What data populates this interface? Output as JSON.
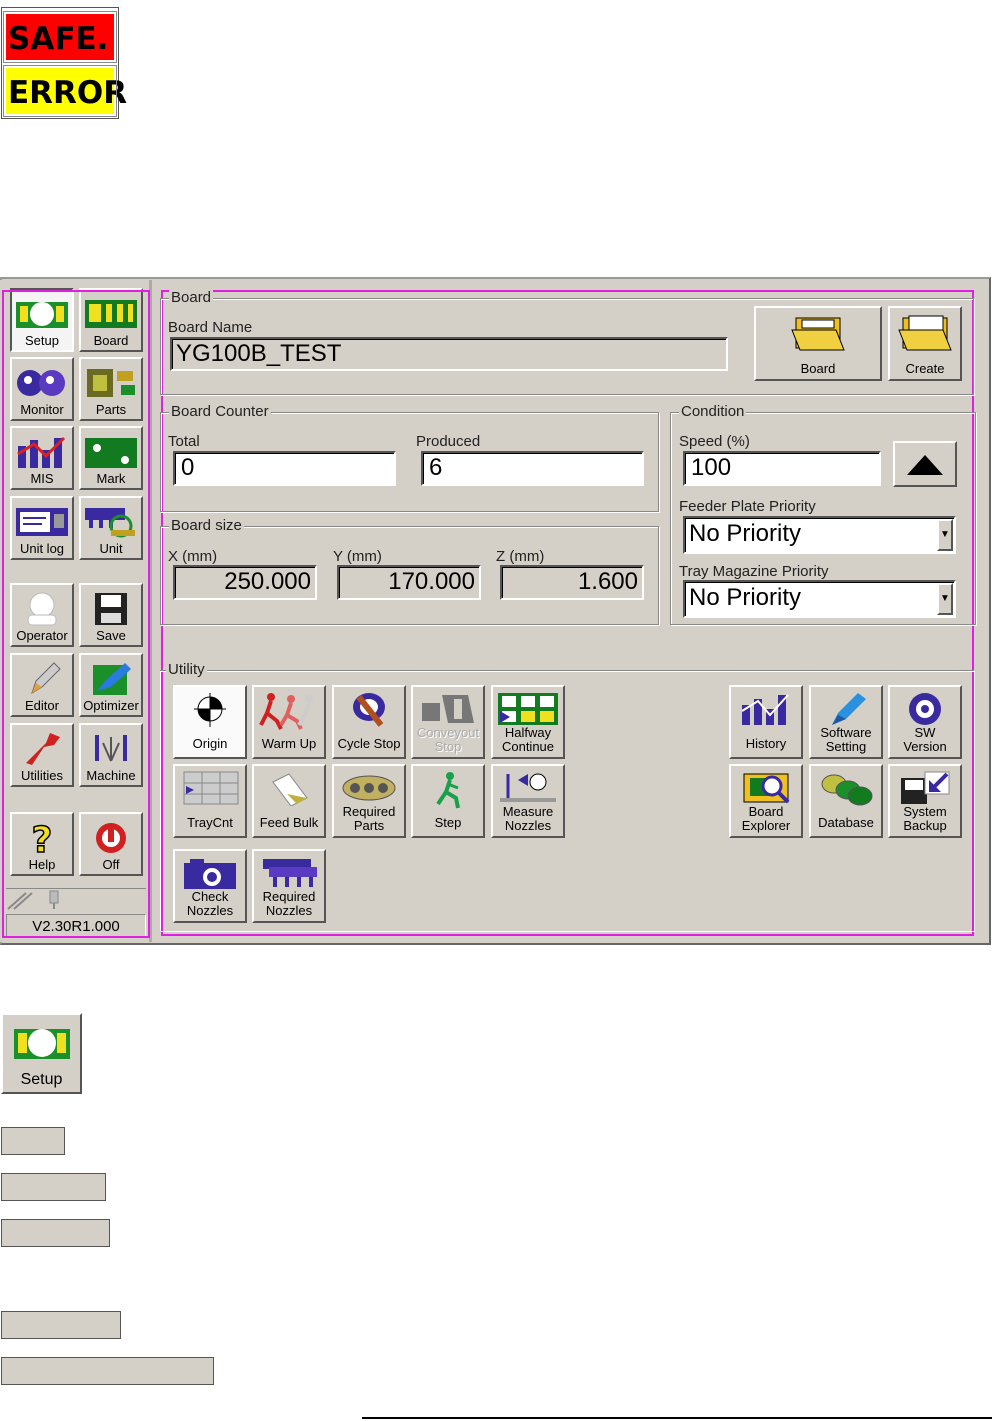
{
  "status": {
    "safe": "SAFE.",
    "error": "ERROR"
  },
  "sidebar": {
    "buttons": [
      {
        "label": "Setup",
        "icon": "setup-icon"
      },
      {
        "label": "Board",
        "icon": "board-icon"
      },
      {
        "label": "Monitor",
        "icon": "monitor-icon"
      },
      {
        "label": "Parts",
        "icon": "parts-icon"
      },
      {
        "label": "MIS",
        "icon": "mis-icon"
      },
      {
        "label": "Mark",
        "icon": "mark-icon"
      },
      {
        "label": "Unit log",
        "icon": "unit-log-icon"
      },
      {
        "label": "Unit",
        "icon": "unit-icon"
      },
      {
        "label": "Operator",
        "icon": "operator-icon"
      },
      {
        "label": "Save",
        "icon": "save-icon"
      },
      {
        "label": "Editor",
        "icon": "editor-icon"
      },
      {
        "label": "Optimizer",
        "icon": "optimizer-icon"
      },
      {
        "label": "Utilities",
        "icon": "utilities-icon"
      },
      {
        "label": "Machine",
        "icon": "machine-icon"
      },
      {
        "label": "Help",
        "icon": "help-icon"
      },
      {
        "label": "Off",
        "icon": "power-off-icon"
      }
    ],
    "version": "V2.30R1.000"
  },
  "board": {
    "group_title": "Board",
    "name_label": "Board Name",
    "name_value": "YG100B_TEST",
    "board_button": "Board",
    "create_button": "Create"
  },
  "counter": {
    "group_title": "Board Counter",
    "total_label": "Total",
    "total_value": "0",
    "produced_label": "Produced",
    "produced_value": "6"
  },
  "size": {
    "group_title": "Board size",
    "x_label": "X (mm)",
    "x_value": "250.000",
    "y_label": "Y (mm)",
    "y_value": "170.000",
    "z_label": "Z (mm)",
    "z_value": "1.600"
  },
  "condition": {
    "group_title": "Condition",
    "speed_label": "Speed (%)",
    "speed_value": "100",
    "feeder_label": "Feeder Plate Priority",
    "feeder_value": "No Priority",
    "tray_label": "Tray Magazine Priority",
    "tray_value": "No Priority"
  },
  "utility": {
    "group_title": "Utility",
    "origin": "Origin",
    "warm_up": "Warm Up",
    "cycle_stop": "Cycle Stop",
    "conveyout_stop_1": "Conveyout",
    "conveyout_stop_2": "Stop",
    "halfway_1": "Halfway",
    "halfway_2": "Continue",
    "history": "History",
    "software_1": "Software",
    "software_2": "Setting",
    "sw_1": "SW",
    "sw_2": "Version",
    "traycnt": "TrayCnt",
    "feed_bulk": "Feed Bulk",
    "req_parts_1": "Required",
    "req_parts_2": "Parts",
    "step": "Step",
    "measure_1": "Measure",
    "measure_2": "Nozzles",
    "explorer_1": "Board",
    "explorer_2": "Explorer",
    "database": "Database",
    "backup_1": "System",
    "backup_2": "Backup",
    "check_1": "Check",
    "check_2": "Nozzles",
    "req_noz_1": "Required",
    "req_noz_2": "Nozzles"
  },
  "legend": {
    "setup_label": "Setup"
  }
}
